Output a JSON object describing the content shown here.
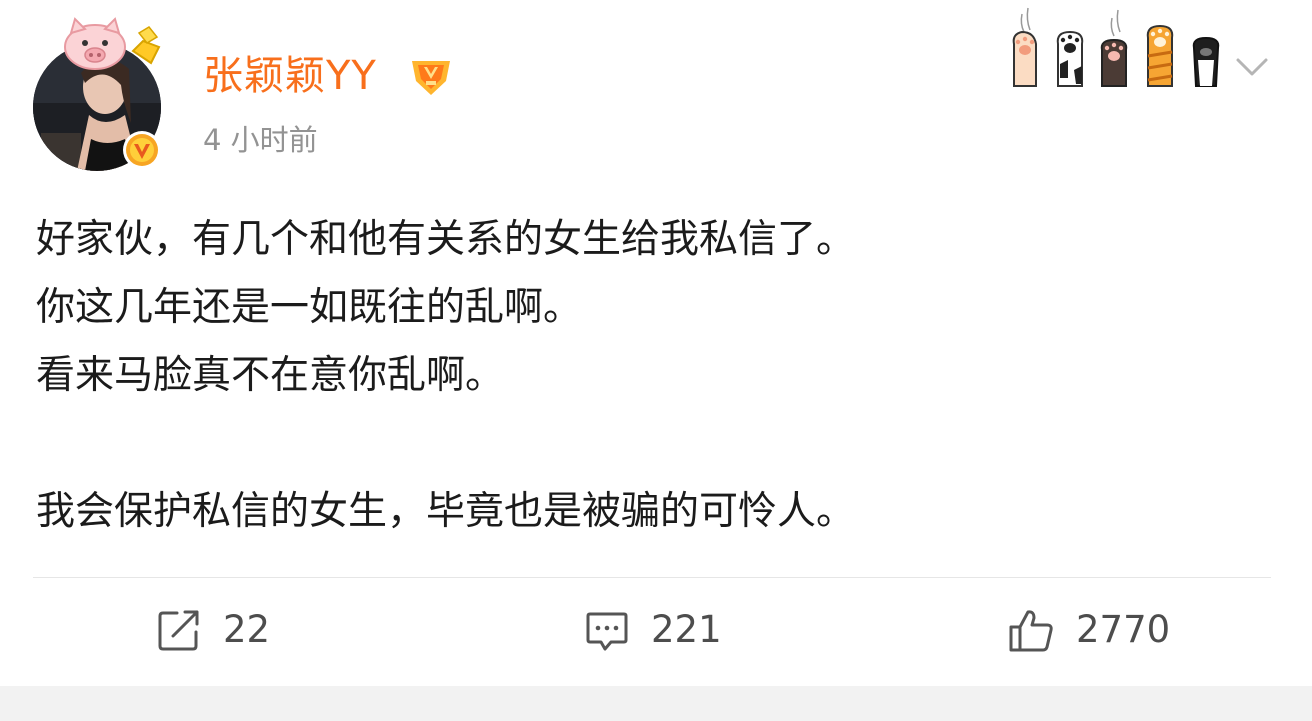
{
  "user": {
    "name": "张颖颖YY",
    "time": "4 小时前"
  },
  "post": {
    "lines": [
      "好家伙，有几个和他有关系的女生给我私信了。",
      "你这几年还是一如既往的乱啊。",
      "看来马脸真不在意你乱啊。",
      "",
      "我会保护私信的女生，毕竟也是被骗的可怜人。"
    ]
  },
  "actions": {
    "repost_count": "22",
    "comment_count": "221",
    "like_count": "2770"
  },
  "icons": {
    "repost": "share-icon",
    "comment": "comment-icon",
    "like": "thumbs-up-icon",
    "more": "chevron-down-icon"
  },
  "colors": {
    "username": "#f86f1c",
    "time": "#939393",
    "text": "#1b1b1b",
    "action_icon": "#555555",
    "divider": "#e6e6e6"
  }
}
